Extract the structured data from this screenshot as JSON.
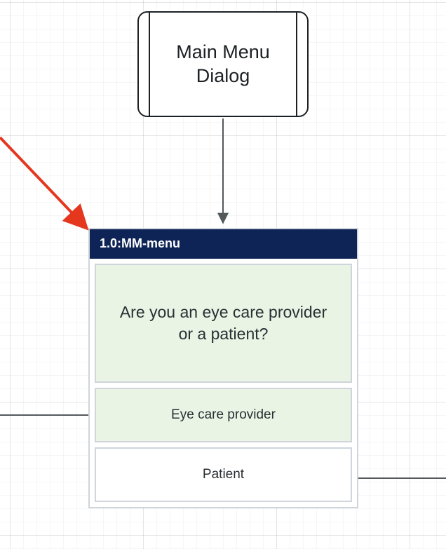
{
  "colors": {
    "node_border": "#1d2124",
    "card_border": "#cfd5da",
    "header_bg": "#0e2456",
    "header_fg": "#ffffff",
    "prompt_bg": "#e9f4e5",
    "pointer": "#e5361e",
    "connector": "#54595c"
  },
  "dialog_node": {
    "label": "Main Menu Dialog"
  },
  "menu_card": {
    "header": "1.0:MM-menu",
    "prompt": "Are you an eye care provider or a patient?",
    "options": [
      {
        "label": "Eye care provider",
        "selected": true
      },
      {
        "label": "Patient",
        "selected": false
      }
    ]
  }
}
